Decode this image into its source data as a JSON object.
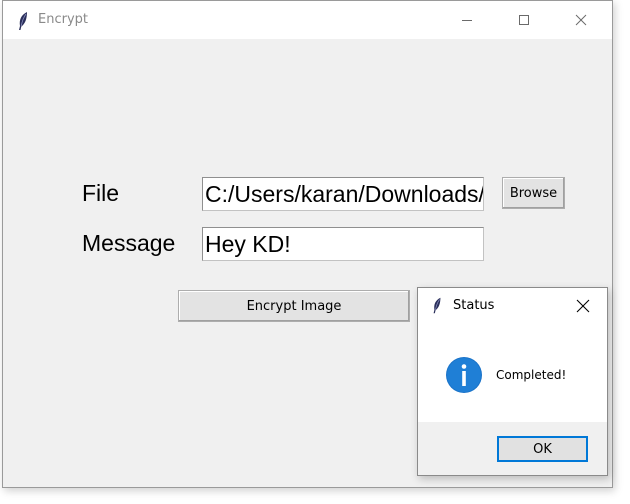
{
  "main_window": {
    "title": "Encrypt",
    "icon": "feather-icon",
    "controls": [
      "minimize-icon",
      "maximize-icon",
      "close-icon"
    ]
  },
  "form": {
    "file_label": "File",
    "file_value": "C:/Users/karan/Downloads/",
    "browse_label": "Browse",
    "message_label": "Message",
    "message_value": "Hey KD!",
    "encrypt_label": "Encrypt Image"
  },
  "status_dialog": {
    "title": "Status",
    "icon": "info-icon",
    "message": "Completed!",
    "ok_label": "OK",
    "accent_color": "#0078d7"
  }
}
